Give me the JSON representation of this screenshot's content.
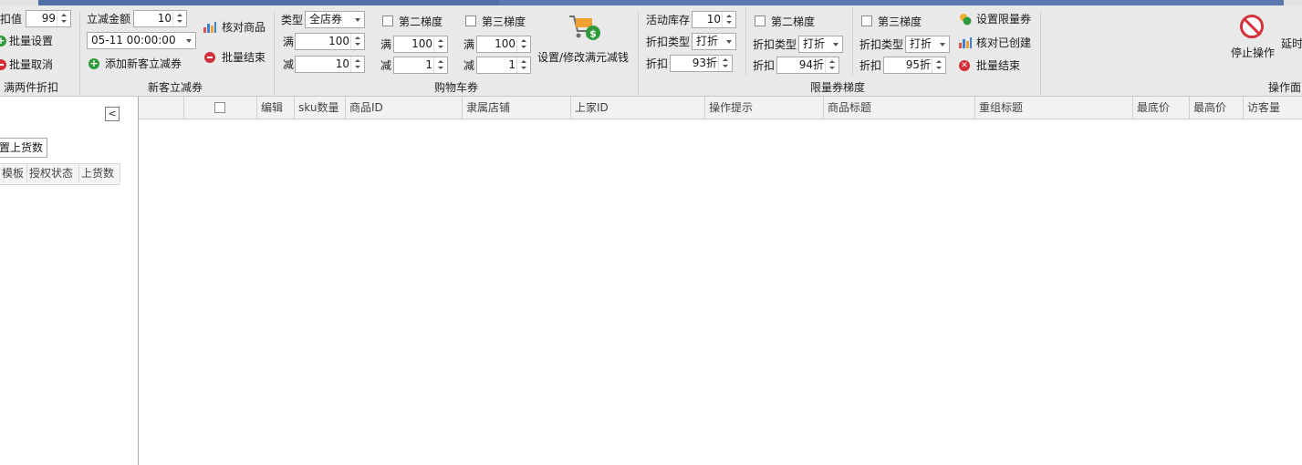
{
  "ribbon": {
    "g1": {
      "discount_label": "扣值",
      "discount_value": "99",
      "batch_set": "批量设置",
      "batch_cancel": "批量取消",
      "title": "满两件折扣"
    },
    "g2": {
      "amount_label": "立减金额",
      "amount_value": "10",
      "datetime": "05-11 00:00:00",
      "add_coupon": "添加新客立减券",
      "check_goods": "核对商品",
      "batch_end": "批量结束",
      "title": "新客立减券"
    },
    "g3": {
      "type_label": "类型",
      "type_value": "全店券",
      "full_label": "满",
      "full_value": "100",
      "minus_label": "减",
      "minus_value": "10",
      "tier2": "第二梯度",
      "t2_full_label": "满",
      "t2_full": "100",
      "t2_minus_label": "减",
      "t2_minus": "1",
      "tier3": "第三梯度",
      "t3_full_label": "满",
      "t3_full": "100",
      "t3_minus_label": "减",
      "t3_minus": "1",
      "set_full_minus": "设置/修改满元减钱",
      "title": "购物车券"
    },
    "g4": {
      "stock_label": "活动库存",
      "stock_value": "10",
      "disc_type_label": "折扣类型",
      "disc_type_value": "打折",
      "disc_label": "折扣",
      "disc_value": "93折",
      "tier2": "第二梯度",
      "t2_type_label": "折扣类型",
      "t2_type_value": "打折",
      "t2_disc_label": "折扣",
      "t2_disc_value": "94折",
      "tier3": "第三梯度",
      "t3_type_label": "折扣类型",
      "t3_type_value": "打折",
      "t3_disc_label": "折扣",
      "t3_disc_value": "95折",
      "set_limit": "设置限量券",
      "check_created": "核对已创建",
      "batch_end": "批量结束",
      "title": "限量券梯度"
    },
    "g5": {
      "stop": "停止操作",
      "delay": "延时",
      "title": "操作面"
    }
  },
  "left_panel": {
    "batch_stock_button": "置上货数",
    "columns": [
      "模板",
      "授权状态",
      "上货数"
    ],
    "collapse_symbol": "<"
  },
  "grid": {
    "columns": [
      "编辑",
      "sku数量",
      "商品ID",
      "隶属店铺",
      "上家ID",
      "操作提示",
      "商品标题",
      "重组标题",
      "最底价",
      "最高价",
      "访客量"
    ]
  },
  "colors": {
    "accent": "#4f6fa6",
    "stop_red": "#d6323c",
    "add_green": "#2e9a3c"
  }
}
